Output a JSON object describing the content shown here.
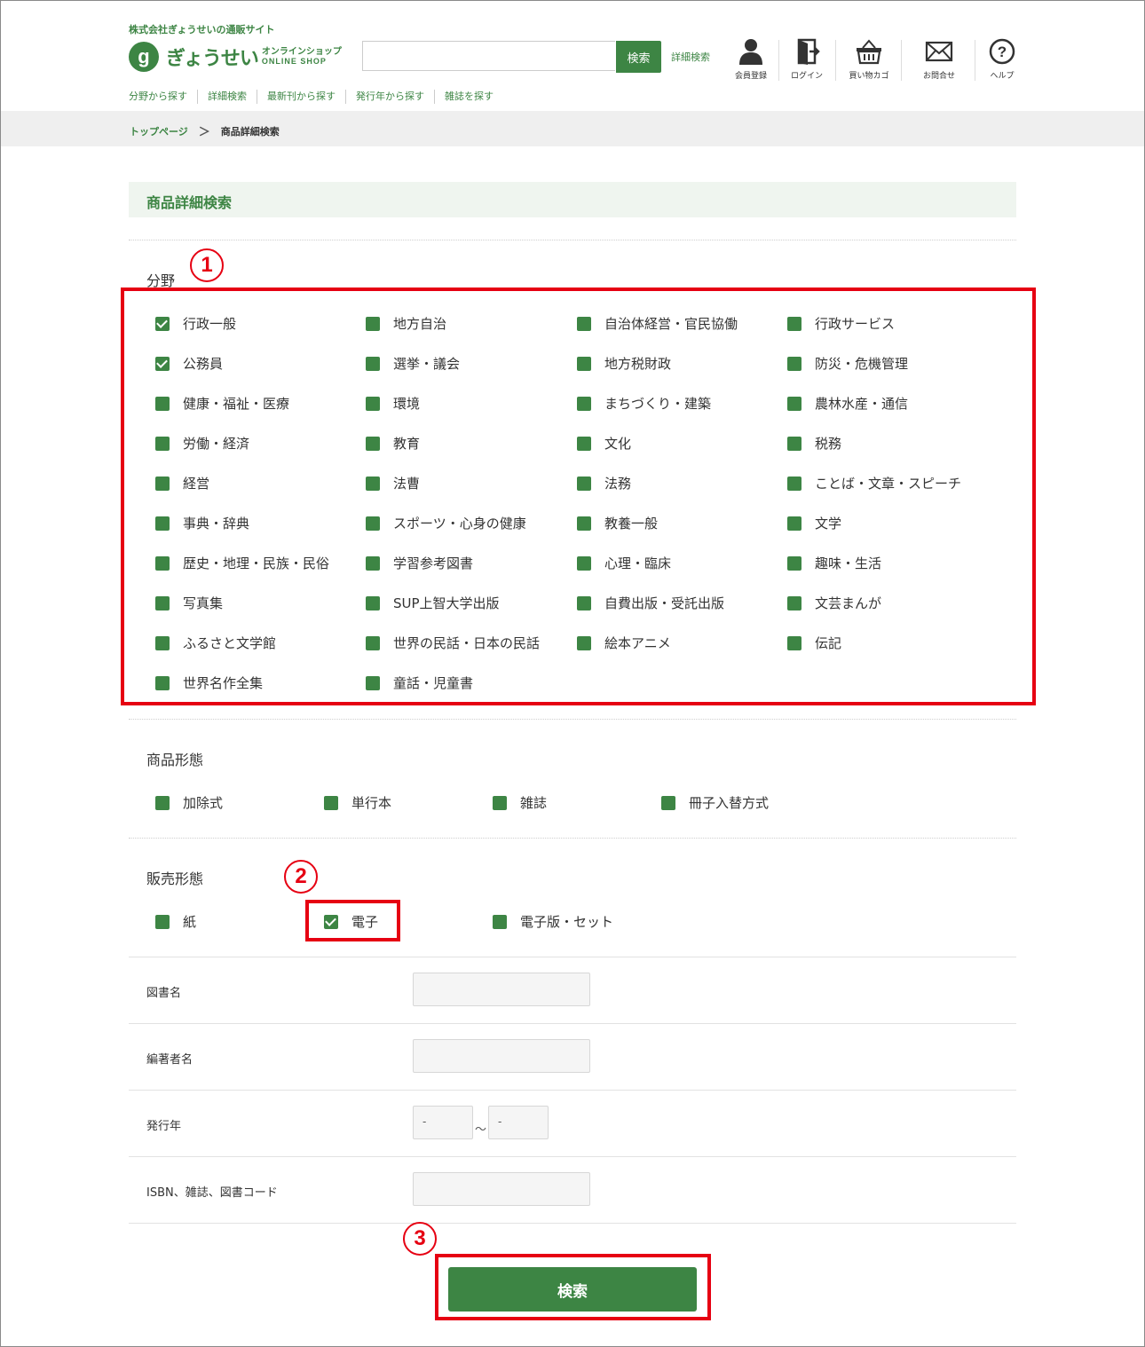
{
  "header": {
    "tagline": "株式会社ぎょうせいの通販サイト",
    "logo_mark": "g",
    "logo_name": "ぎょうせい",
    "logo_sub_jp": "オンラインショップ",
    "logo_sub_en": "ONLINE SHOP",
    "search_button": "検索",
    "advanced_search_link": "詳細検索",
    "icons": [
      {
        "name": "member-icon",
        "label": "会員登録"
      },
      {
        "name": "login-icon",
        "label": "ログイン"
      },
      {
        "name": "cart-icon",
        "label": "買い物カゴ"
      },
      {
        "name": "mail-icon",
        "label": "お問合せ"
      },
      {
        "name": "help-icon",
        "label": "ヘルプ"
      }
    ]
  },
  "subnav": [
    "分野から探す",
    "詳細検索",
    "最新刊から探す",
    "発行年から探す",
    "雑誌を探す"
  ],
  "breadcrumb": {
    "home": "トップページ",
    "separator": "＞",
    "current": "商品詳細検索"
  },
  "page_title": "商品詳細検索",
  "field_section": {
    "label": "分野",
    "items": [
      {
        "label": "行政一般",
        "checked": true
      },
      {
        "label": "地方自治",
        "checked": false
      },
      {
        "label": "自治体経営・官民協働",
        "checked": false
      },
      {
        "label": "行政サービス",
        "checked": false
      },
      {
        "label": "公務員",
        "checked": true
      },
      {
        "label": "選挙・議会",
        "checked": false
      },
      {
        "label": "地方税財政",
        "checked": false
      },
      {
        "label": "防災・危機管理",
        "checked": false
      },
      {
        "label": "健康・福祉・医療",
        "checked": false
      },
      {
        "label": "環境",
        "checked": false
      },
      {
        "label": "まちづくり・建築",
        "checked": false
      },
      {
        "label": "農林水産・通信",
        "checked": false
      },
      {
        "label": "労働・経済",
        "checked": false
      },
      {
        "label": "教育",
        "checked": false
      },
      {
        "label": "文化",
        "checked": false
      },
      {
        "label": "税務",
        "checked": false
      },
      {
        "label": "経営",
        "checked": false
      },
      {
        "label": "法曹",
        "checked": false
      },
      {
        "label": "法務",
        "checked": false
      },
      {
        "label": "ことば・文章・スピーチ",
        "checked": false
      },
      {
        "label": "事典・辞典",
        "checked": false
      },
      {
        "label": "スポーツ・心身の健康",
        "checked": false
      },
      {
        "label": "教養一般",
        "checked": false
      },
      {
        "label": "文学",
        "checked": false
      },
      {
        "label": "歴史・地理・民族・民俗",
        "checked": false
      },
      {
        "label": "学習参考図書",
        "checked": false
      },
      {
        "label": "心理・臨床",
        "checked": false
      },
      {
        "label": "趣味・生活",
        "checked": false
      },
      {
        "label": "写真集",
        "checked": false
      },
      {
        "label": "SUP上智大学出版",
        "checked": false
      },
      {
        "label": "自費出版・受託出版",
        "checked": false
      },
      {
        "label": "文芸まんが",
        "checked": false
      },
      {
        "label": "ふるさと文学館",
        "checked": false
      },
      {
        "label": "世界の民話・日本の民話",
        "checked": false
      },
      {
        "label": "絵本アニメ",
        "checked": false
      },
      {
        "label": "伝記",
        "checked": false
      },
      {
        "label": "世界名作全集",
        "checked": false
      },
      {
        "label": "童話・児童書",
        "checked": false
      }
    ]
  },
  "product_form": {
    "label": "商品形態",
    "items": [
      {
        "label": "加除式",
        "checked": false
      },
      {
        "label": "単行本",
        "checked": false
      },
      {
        "label": "雑誌",
        "checked": false
      },
      {
        "label": "冊子入替方式",
        "checked": false
      }
    ]
  },
  "sales_form": {
    "label": "販売形態",
    "items": [
      {
        "label": "紙",
        "checked": false
      },
      {
        "label": "電子",
        "checked": true
      },
      {
        "label": "電子版・セット",
        "checked": false
      }
    ]
  },
  "fields": {
    "book_name": "図書名",
    "author": "編著者名",
    "year": "発行年",
    "year_from": "-",
    "year_sep": "～",
    "year_to": "-",
    "isbn": "ISBN、雑誌、図書コード"
  },
  "submit_label": "検索",
  "annotations": [
    "1",
    "2",
    "3"
  ],
  "colors": {
    "brand_green": "#3d8544",
    "annotation_red": "#e60012"
  }
}
